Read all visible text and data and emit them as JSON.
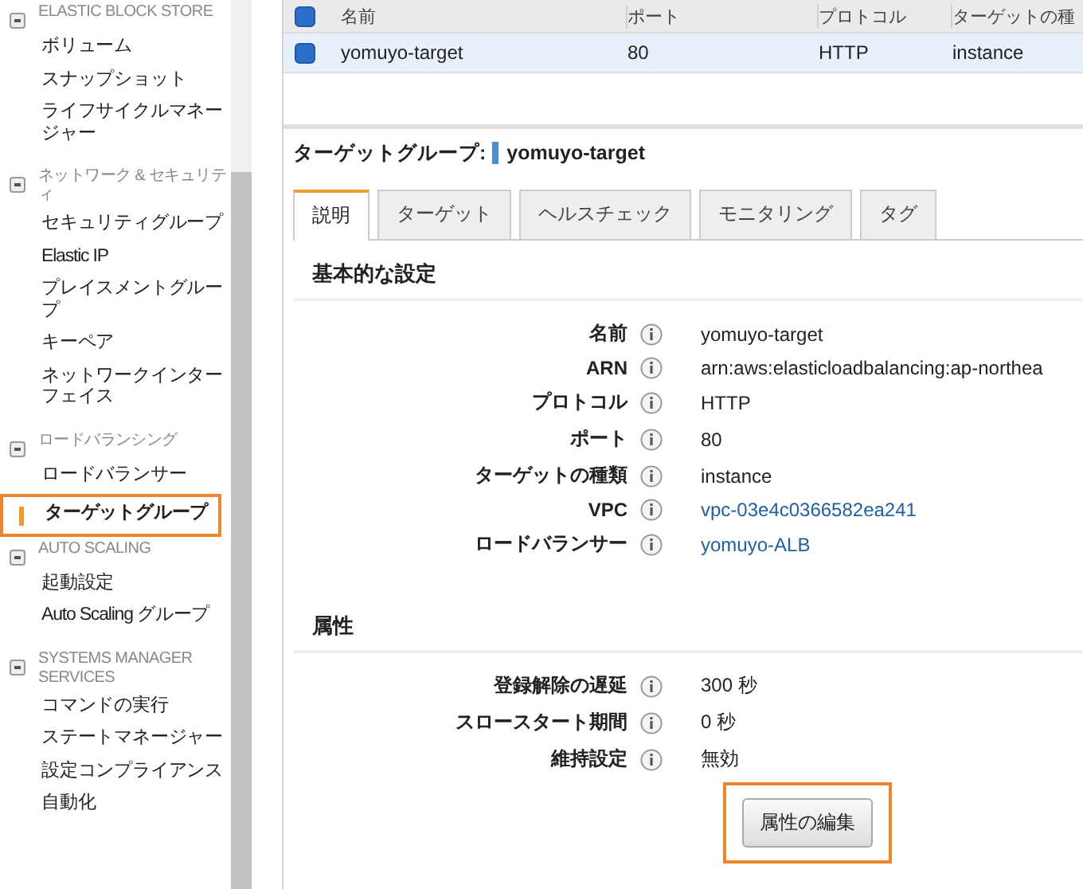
{
  "sidebar": {
    "sections": [
      {
        "title": "ELASTIC BLOCK STORE",
        "expanded": true,
        "items": [
          {
            "label": "ボリューム",
            "selected": false,
            "highlighted": false
          },
          {
            "label": "スナップショット",
            "selected": false,
            "highlighted": false
          },
          {
            "label": "ライフサイクルマネージャー",
            "selected": false,
            "highlighted": false
          }
        ]
      },
      {
        "title": "ネットワーク & セキュリティ",
        "expanded": true,
        "items": [
          {
            "label": "セキュリティグループ",
            "selected": false,
            "highlighted": false
          },
          {
            "label": "Elastic IP",
            "selected": false,
            "highlighted": false
          },
          {
            "label": "プレイスメントグループ",
            "selected": false,
            "highlighted": false
          },
          {
            "label": "キーペア",
            "selected": false,
            "highlighted": false
          },
          {
            "label": "ネットワークインターフェイス",
            "selected": false,
            "highlighted": false
          }
        ]
      },
      {
        "title": "ロードバランシング",
        "expanded": true,
        "items": [
          {
            "label": "ロードバランサー",
            "selected": false,
            "highlighted": false
          },
          {
            "label": "ターゲットグループ",
            "selected": true,
            "highlighted": true
          }
        ]
      },
      {
        "title": "AUTO SCALING",
        "expanded": true,
        "items": [
          {
            "label": "起動設定",
            "selected": false,
            "highlighted": false
          },
          {
            "label": "Auto Scaling グループ",
            "selected": false,
            "highlighted": false
          }
        ]
      },
      {
        "title": "SYSTEMS MANAGER SERVICES",
        "expanded": true,
        "items": [
          {
            "label": "コマンドの実行",
            "selected": false,
            "highlighted": false
          },
          {
            "label": "ステートマネージャー",
            "selected": false,
            "highlighted": false
          },
          {
            "label": "設定コンプライアンス",
            "selected": false,
            "highlighted": false
          },
          {
            "label": "自動化",
            "selected": false,
            "highlighted": false
          }
        ]
      }
    ]
  },
  "table": {
    "all_selected": true,
    "columns": [
      "名前",
      "ポート",
      "プロトコル",
      "ターゲットの種"
    ],
    "rows": [
      {
        "selected": true,
        "cells": [
          "yomuyo-target",
          "80",
          "HTTP",
          "instance"
        ]
      }
    ]
  },
  "detail": {
    "label": "ターゲットグループ:",
    "name": "yomuyo-target",
    "tabs": [
      {
        "label": "説明",
        "selected": true
      },
      {
        "label": "ターゲット",
        "selected": false
      },
      {
        "label": "ヘルスチェック",
        "selected": false
      },
      {
        "label": "モニタリング",
        "selected": false
      },
      {
        "label": "タグ",
        "selected": false
      }
    ],
    "sections": [
      {
        "title": "基本的な設定",
        "fields": [
          {
            "label": "名前",
            "value": "yomuyo-target",
            "link": false
          },
          {
            "label": "ARN",
            "value": "arn:aws:elasticloadbalancing:ap-northea",
            "link": false
          },
          {
            "label": "プロトコル",
            "value": "HTTP",
            "link": false
          },
          {
            "label": "ポート",
            "value": "80",
            "link": false
          },
          {
            "label": "ターゲットの種類",
            "value": "instance",
            "link": false
          },
          {
            "label": "VPC",
            "value": "vpc-03e4c0366582ea241",
            "link": true
          },
          {
            "label": "ロードバランサー",
            "value": "yomuyo-ALB",
            "link": true
          }
        ]
      },
      {
        "title": "属性",
        "fields": [
          {
            "label": "登録解除の遅延",
            "value": "300 秒",
            "link": false
          },
          {
            "label": "スロースタート期間",
            "value": "0 秒",
            "link": false
          },
          {
            "label": "維持設定",
            "value": "無効",
            "link": false
          }
        ],
        "button": {
          "label": "属性の編集",
          "highlighted": true
        }
      }
    ]
  }
}
